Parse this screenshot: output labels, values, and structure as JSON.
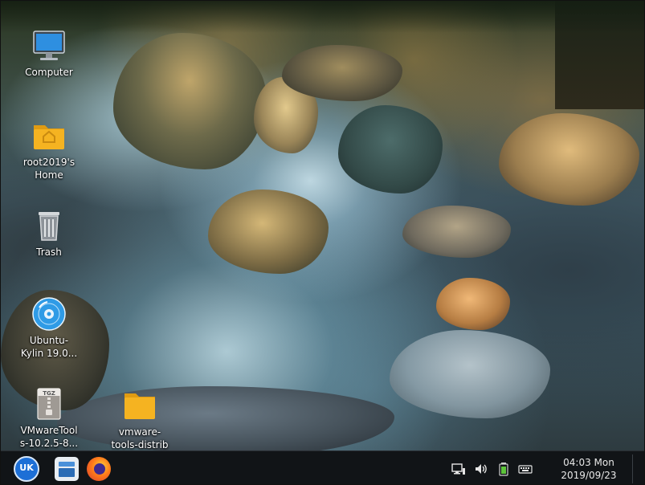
{
  "desktop": {
    "icons": [
      {
        "label": "Computer",
        "icon": "monitor-icon"
      },
      {
        "label": "root2019's\nHome",
        "icon": "home-folder-icon"
      },
      {
        "label": "Trash",
        "icon": "trash-icon"
      },
      {
        "label": "Ubuntu-\nKylin 19.0...",
        "icon": "disc-icon"
      },
      {
        "label": "VMwareTool\ns-10.2.5-8...",
        "icon": "tgz-archive-icon"
      },
      {
        "label": "vmware-\ntools-distrib",
        "icon": "folder-icon"
      }
    ],
    "archive_badge": "TGZ"
  },
  "taskbar": {
    "start_icon": "ukui-start-icon",
    "launchers": [
      {
        "name": "file-manager",
        "icon": "file-manager-icon"
      },
      {
        "name": "firefox",
        "icon": "firefox-icon"
      }
    ],
    "start_text": "UK",
    "tray": [
      "network-icon",
      "volume-icon",
      "battery-icon",
      "keyboard-icon"
    ],
    "clock": {
      "time": "04:03 Mon",
      "date": "2019/09/23"
    }
  },
  "colors": {
    "taskbar": "#111417",
    "folder": "#f5b321",
    "start_blue": "#1d6fd6",
    "firefox_orange": "#ff7a1a",
    "battery_green": "#5dc43b"
  }
}
